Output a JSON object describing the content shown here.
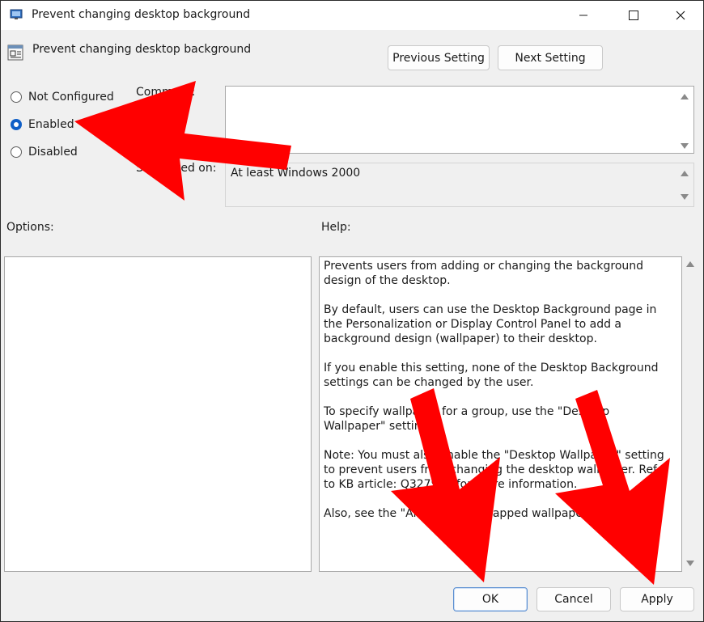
{
  "window": {
    "title": "Prevent changing desktop background",
    "minimize_icon": "minimize-icon",
    "maximize_icon": "maximize-icon",
    "close_icon": "close-icon"
  },
  "header": {
    "title": "Prevent changing desktop background",
    "icon": "policy-setting-icon",
    "previous_label": "Previous Setting",
    "next_label": "Next Setting"
  },
  "state": {
    "options": [
      {
        "label": "Not Configured",
        "checked": false
      },
      {
        "label": "Enabled",
        "checked": true
      },
      {
        "label": "Disabled",
        "checked": false
      }
    ]
  },
  "comment": {
    "label": "Comment:",
    "value": ""
  },
  "supported": {
    "label": "Supported on:",
    "value": "At least Windows 2000"
  },
  "options_pane": {
    "label": "Options:"
  },
  "help_pane": {
    "label": "Help:",
    "paragraphs": [
      "Prevents users from adding or changing the background design of the desktop.",
      "By default, users can use the Desktop Background page in the Personalization or Display Control Panel to add a background design (wallpaper) to their desktop.",
      "If you enable this setting, none of the Desktop Background settings can be changed by the user.",
      "To specify wallpaper for a group, use the \"Desktop Wallpaper\" setting.",
      "Note: You must also enable the \"Desktop Wallpaper\" setting to prevent users from changing the desktop wallpaper. Refer to KB article: Q327998 for more information.",
      "Also, see the \"Allow only bitmapped wallpaper\" setting."
    ]
  },
  "footer": {
    "ok_label": "OK",
    "cancel_label": "Cancel",
    "apply_label": "Apply"
  },
  "annotations": {
    "arrow_color": "#ff0000"
  }
}
